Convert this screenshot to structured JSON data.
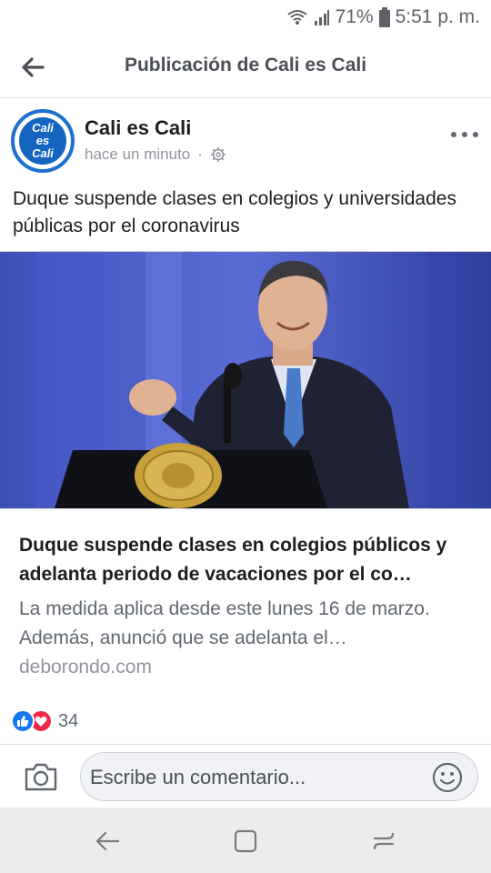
{
  "status_bar": {
    "battery": "71%",
    "time": "5:51 p. m."
  },
  "header": {
    "title": "Publicación de Cali es Cali",
    "back_icon": "arrow-left-icon"
  },
  "post": {
    "author": "Cali es Cali",
    "avatar_lines": [
      "Cali",
      "es",
      "Cali"
    ],
    "timestamp": "hace un minuto",
    "separator": "·",
    "text": "Duque suspende clases en colegios y universidades públicas por el coronavirus"
  },
  "link_card": {
    "title": "Duque suspende clases en colegios públicos y adelanta periodo de vacaciones por el co…",
    "description": "La medida aplica desde este lunes 16 de marzo. Además, anunció que se adelanta el…",
    "domain": "deborondo.com"
  },
  "reactions": {
    "count": "34",
    "types": [
      "like-icon",
      "love-icon"
    ]
  },
  "comment_bar": {
    "placeholder": "Escribe un comentario...",
    "camera_icon": "camera-icon",
    "emoji_icon": "smiley-icon"
  },
  "colors": {
    "facebook_blue": "#1877f2",
    "love_red": "#f0284a",
    "header_text": "#4b4f56"
  }
}
